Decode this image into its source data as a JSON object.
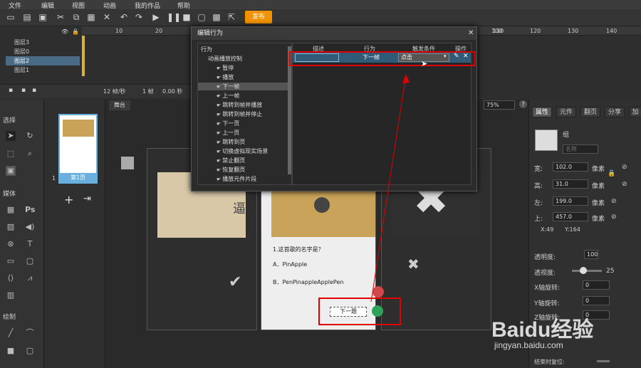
{
  "menu": [
    "文件",
    "编辑",
    "视图",
    "动画",
    "我的作品",
    "帮助"
  ],
  "toolbar": {
    "publish": "发布"
  },
  "timeline": {
    "ruler": [
      "10",
      "20",
      "100",
      "110",
      "120",
      "130",
      "140"
    ],
    "layers": [
      "图层3",
      "图层0",
      "图层2",
      "图层1"
    ],
    "fps": "12 帧/秒",
    "frame": "1 帧",
    "time": "0.00 秒"
  },
  "left_panel": {
    "select": "选择",
    "media": "媒体",
    "draw": "绘制"
  },
  "page_panel": {
    "page_label": "第1页",
    "page_num": "1"
  },
  "stage": {
    "tab": "舞台",
    "zoom": "75%",
    "question": "1.这首歌的名字是？",
    "option_a": "A．PinApple",
    "option_b": "B．PenPinappleApplePen",
    "next_button": "下一题",
    "side_char": "逼"
  },
  "right_panel": {
    "tabs": [
      "属性",
      "元件",
      "翻页",
      "分享",
      "加"
    ],
    "type": "组",
    "name_placeholder": "名称",
    "props": [
      {
        "label": "宽:",
        "value": "102.0",
        "unit": "像素"
      },
      {
        "label": "高:",
        "value": "31.0",
        "unit": "像素"
      },
      {
        "label": "左:",
        "value": "199.0",
        "unit": "像素"
      },
      {
        "label": "上:",
        "value": "457.0",
        "unit": "像素"
      }
    ],
    "x_readout": "X:49",
    "y_readout": "Y:164",
    "transparency_label": "透明度:",
    "transparency_value": "100",
    "opacity_label": "透视度:",
    "opacity_value": "25",
    "x_rotate_label": "X轴旋转:",
    "x_rotate_value": "0",
    "y_rotate_label": "Y轴旋转:",
    "y_rotate_value": "0",
    "z_rotate_label": "Z轴旋转:",
    "z_rotate_value": "0",
    "reset_label": "结束时复位:"
  },
  "dialog": {
    "title": "编辑行为",
    "tree": [
      "行为",
      "动画播放控制",
      "暂停",
      "播放",
      "下一帧",
      "上一帧",
      "跳转到帧并播放",
      "跳转到帧并停止",
      "下一页",
      "上一页",
      "跳转到页",
      "切换虚拟现实场景",
      "禁止翻页",
      "恢复翻页",
      "播放元件片段"
    ],
    "columns": [
      "描述",
      "行为",
      "触发条件",
      "操作"
    ],
    "row": {
      "desc": "",
      "behavior": "下一帧",
      "trigger": "点击"
    }
  },
  "watermark": {
    "brand": "Baidu经验",
    "url": "jingyan.baidu.com"
  },
  "colors": {
    "accent": "#f39200",
    "highlight": "#e00000",
    "selection": "#2f5a78"
  }
}
